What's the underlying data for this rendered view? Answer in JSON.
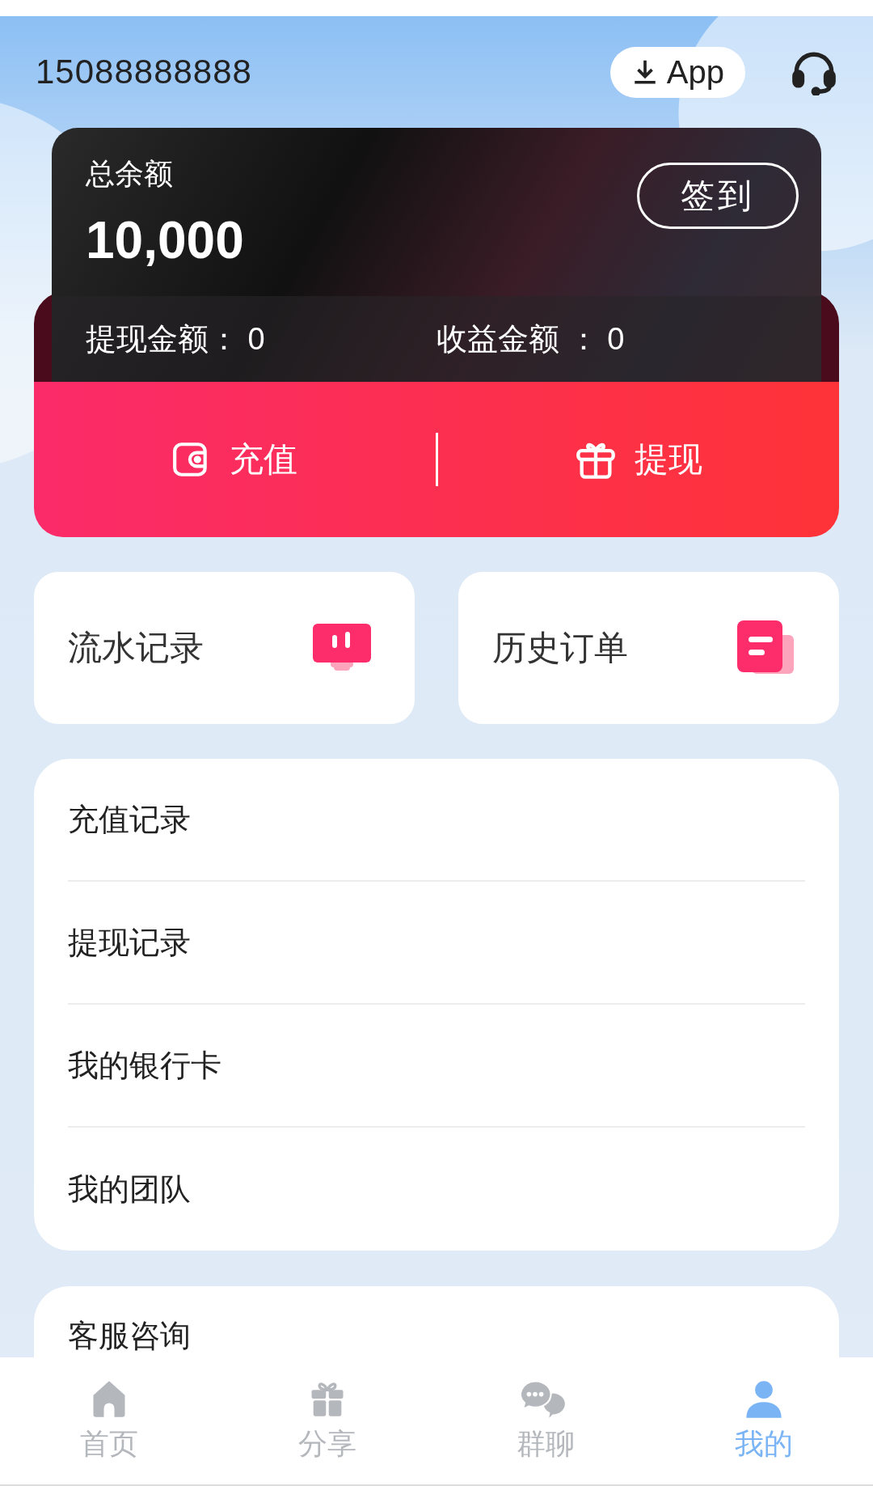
{
  "header": {
    "phone": "15088888888",
    "app_button": "App"
  },
  "balance_card": {
    "title": "总余额",
    "amount": "10,000",
    "checkin_button": "签到",
    "stats": [
      {
        "label": "提现金额：",
        "value": "0"
      },
      {
        "label": "收益金额 ：",
        "value": "0"
      }
    ]
  },
  "actions": [
    {
      "kind": "recharge",
      "label": "充值"
    },
    {
      "kind": "withdraw",
      "label": "提现"
    }
  ],
  "shortcuts": [
    {
      "kind": "monitor",
      "label": "流水记录"
    },
    {
      "kind": "document",
      "label": "历史订单"
    }
  ],
  "menu": [
    "充值记录",
    "提现记录",
    "我的银行卡",
    "我的团队"
  ],
  "support_card": {
    "label": "客服咨询"
  },
  "tab_bar": [
    {
      "kind": "home",
      "label": "首页",
      "selected": false
    },
    {
      "kind": "gift",
      "label": "分享",
      "selected": false
    },
    {
      "kind": "chat",
      "label": "群聊",
      "selected": false
    },
    {
      "kind": "person",
      "label": "我的",
      "selected": true
    }
  ]
}
